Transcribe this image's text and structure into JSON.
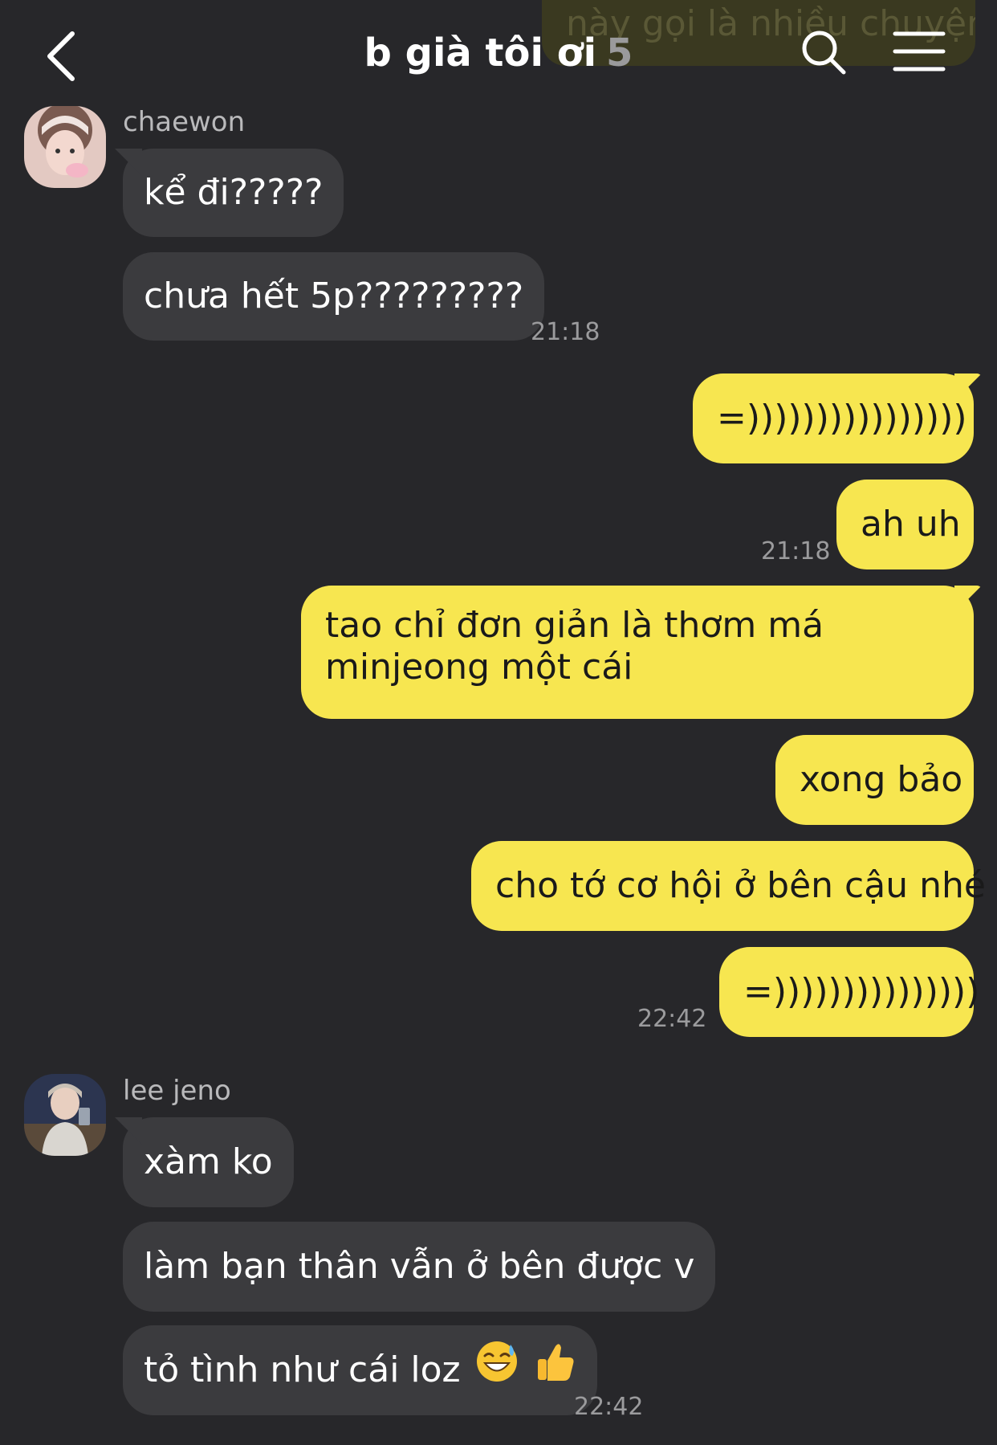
{
  "header": {
    "title": "b già tôi ơi",
    "member_count": "5",
    "icons": [
      "back-icon",
      "search-icon",
      "menu-icon"
    ]
  },
  "faded_message": "này gọi là nhiều chuyện",
  "messages": {
    "chaewon": {
      "name": "chaewon",
      "texts": [
        "kể đi?????",
        "chưa hết 5p?????????"
      ],
      "time": "21:18"
    },
    "me_group1": {
      "texts": [
        "=))))))))))))))))",
        "ah uh"
      ],
      "time": "21:18"
    },
    "me_group2": {
      "texts": [
        "tao chỉ đơn giản là thơm má minjeong một cái",
        "xong bảo",
        "cho tớ cơ hội ở bên cậu nhé",
        "=)))))))))))))))"
      ],
      "time": "22:42"
    },
    "jeno": {
      "name": "lee jeno",
      "texts": [
        "xàm ko",
        "làm bạn thân vẫn ở bên được v",
        "tỏ tình như cái loz"
      ],
      "emojis": [
        "sweat-smile-emoji",
        "thumbs-up-emoji"
      ],
      "time": "22:42"
    }
  },
  "colors": {
    "background": "#27272a",
    "incoming_bubble": "#3b3b3e",
    "outgoing_bubble": "#f7e650"
  }
}
